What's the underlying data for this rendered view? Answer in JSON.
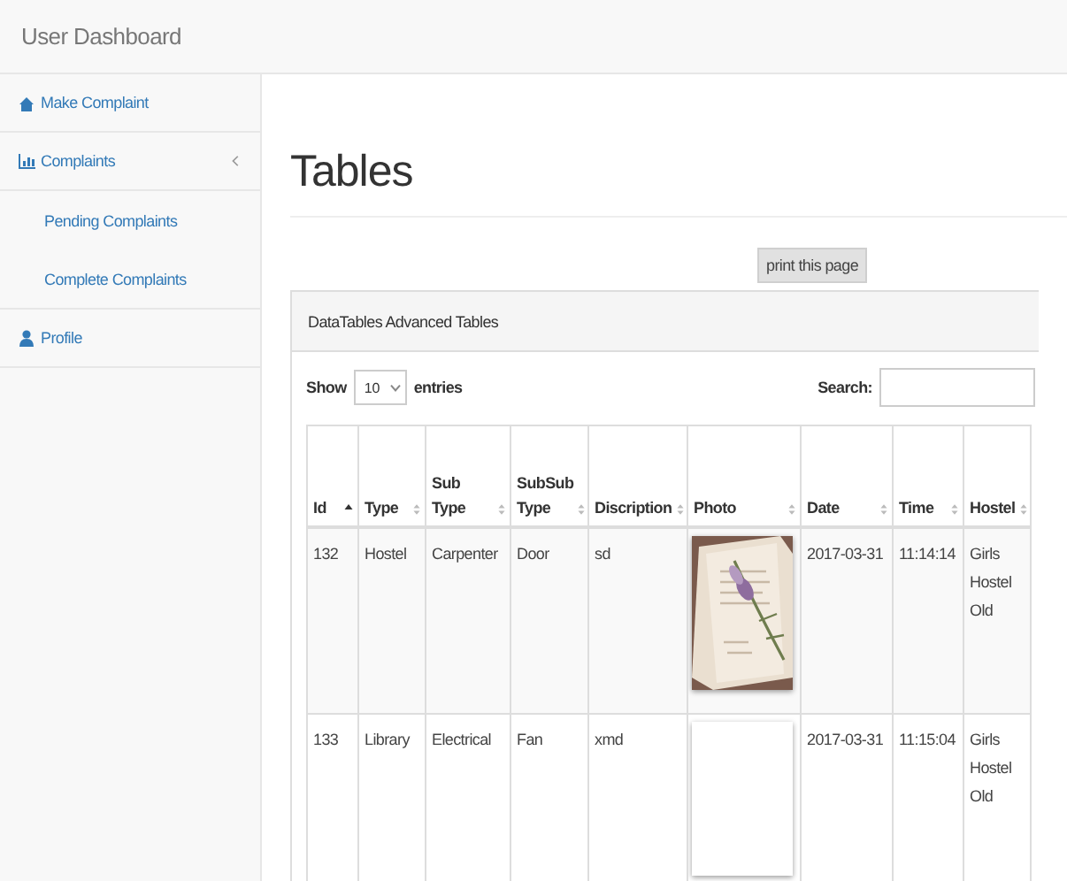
{
  "header": {
    "title": "User Dashboard"
  },
  "sidebar": {
    "items": [
      {
        "label": "Make Complaint"
      },
      {
        "label": "Complaints",
        "expanded": true,
        "children": [
          {
            "label": "Pending Complaints"
          },
          {
            "label": "Complete Complaints"
          }
        ]
      },
      {
        "label": "Profile"
      }
    ]
  },
  "page_title": "Tables",
  "print_button": "print this page",
  "panel": {
    "title": "DataTables Advanced Tables",
    "length": {
      "before": "Show",
      "value": "10",
      "after": "entries"
    },
    "search": {
      "label": "Search:"
    },
    "table": {
      "columns": [
        {
          "label": "Id",
          "sorted": true
        },
        {
          "label": "Type",
          "sorted": false
        },
        {
          "label": "Sub Type",
          "sorted": false
        },
        {
          "label": "SubSub Type",
          "sorted": false
        },
        {
          "label": "Discription",
          "sorted": false
        },
        {
          "label": "Photo",
          "sorted": false
        },
        {
          "label": "Date",
          "sorted": false
        },
        {
          "label": "Time",
          "sorted": false
        },
        {
          "label": "Hostel",
          "sorted": false
        }
      ],
      "rows": [
        {
          "cells": [
            "132",
            "Hostel",
            "Carpenter",
            "Door",
            "sd",
            {
              "kind": "picture"
            },
            "2017-03-31",
            "11:14:14",
            "Girls Hostel Old"
          ]
        },
        {
          "cells": [
            "133",
            "Library",
            "Electrical",
            "Fan",
            "xmd",
            {
              "kind": "blank"
            },
            "2017-03-31",
            "11:15:04",
            "Girls Hostel Old"
          ]
        }
      ]
    }
  }
}
